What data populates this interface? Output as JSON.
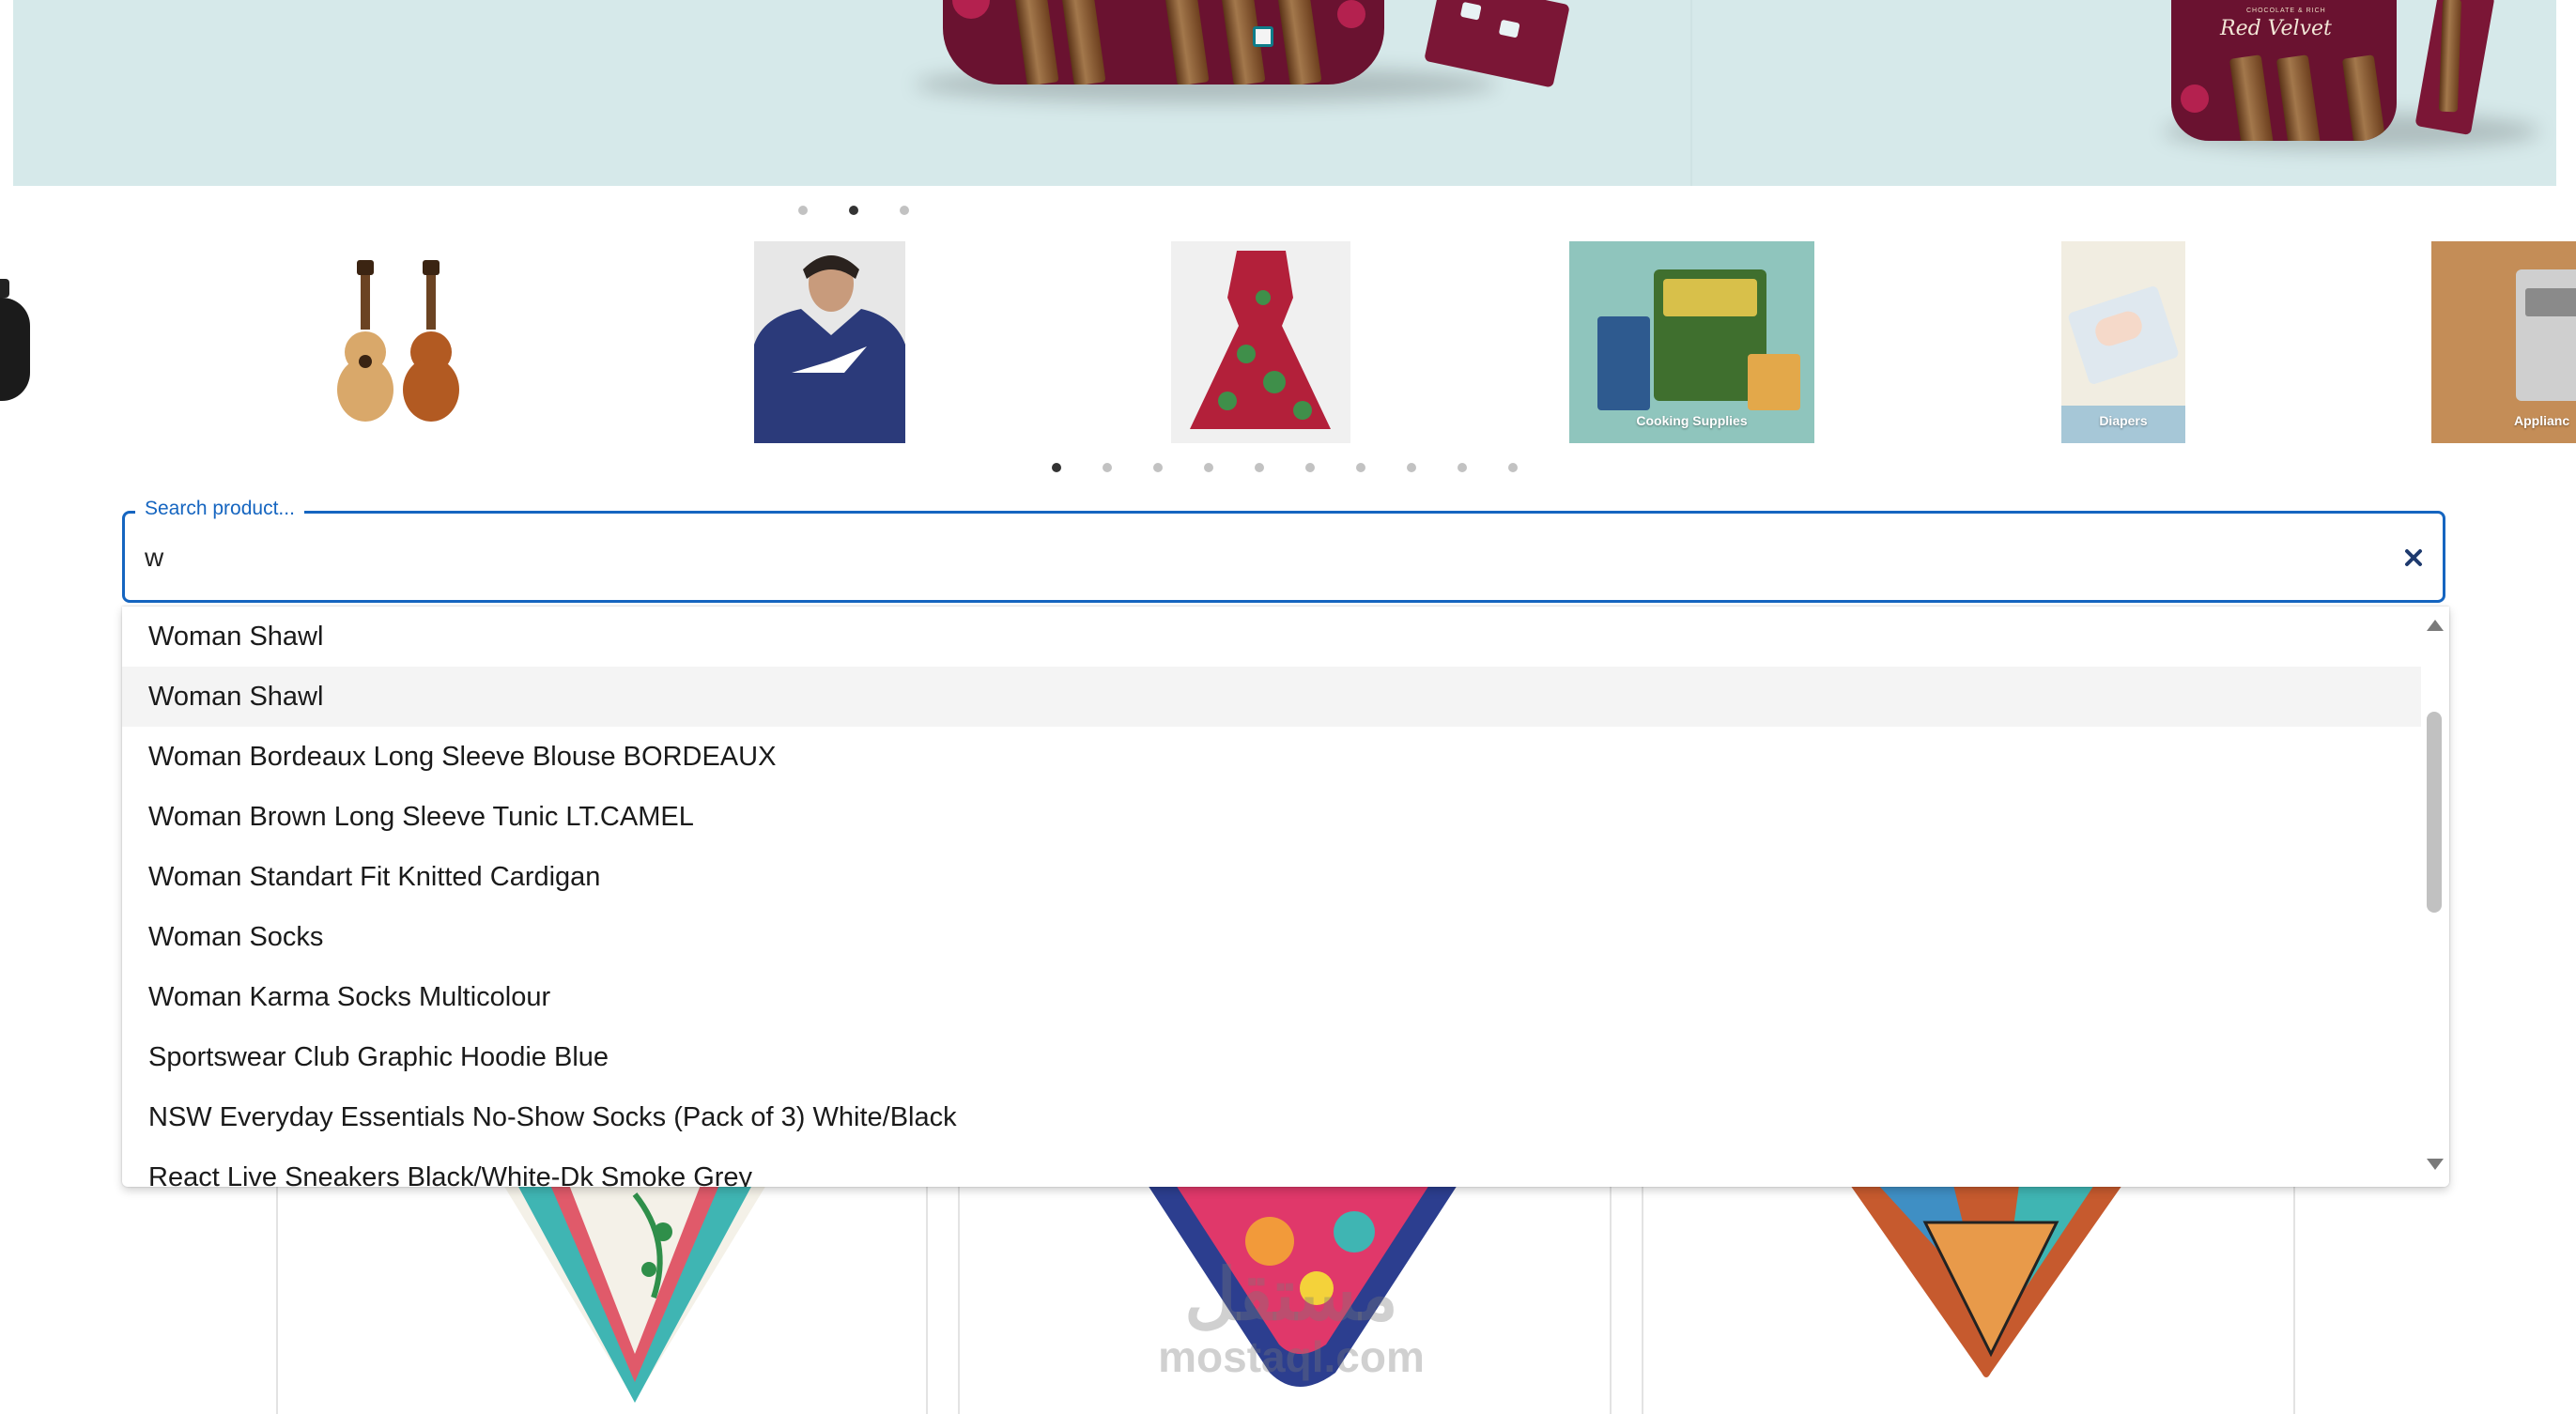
{
  "hero": {
    "brand": "Red Velvet",
    "brand_subtitle": "CHOCOLATE & RICH",
    "dots": {
      "count": 3,
      "active": 1
    }
  },
  "categories": {
    "items": [
      {
        "icon": "speaker-icon",
        "label": ""
      },
      {
        "icon": "guitar-icon",
        "label": ""
      },
      {
        "icon": "hoodie-icon",
        "label": ""
      },
      {
        "icon": "dress-icon",
        "label": ""
      },
      {
        "icon": "cooking-supplies-icon",
        "label": "Cooking Supplies"
      },
      {
        "icon": "diapers-icon",
        "label": "Diapers"
      },
      {
        "icon": "appliances-icon",
        "label": "Applianc"
      }
    ],
    "dots": {
      "count": 10,
      "active": 0
    }
  },
  "search": {
    "legend": "Search product...",
    "value": "w",
    "clear_icon": "close-icon",
    "accent": "#1565c0"
  },
  "results": [
    "Woman Shawl",
    "Woman Shawl",
    "Woman Bordeaux Long Sleeve Blouse BORDEAUX",
    "Woman Brown Long Sleeve Tunic LT.CAMEL",
    "Woman Standart Fit Knitted Cardigan",
    "Woman Socks",
    "Woman Karma Socks Multicolour",
    "Sportswear Club Graphic Hoodie Blue",
    "NSW Everyday Essentials No-Show Socks (Pack of 3) White/Black",
    "React Live Sneakers Black/White-Dk Smoke Grey"
  ],
  "highlighted_result": 1,
  "watermark": {
    "arabic": "مستقل",
    "latin": "mostaql.com"
  }
}
